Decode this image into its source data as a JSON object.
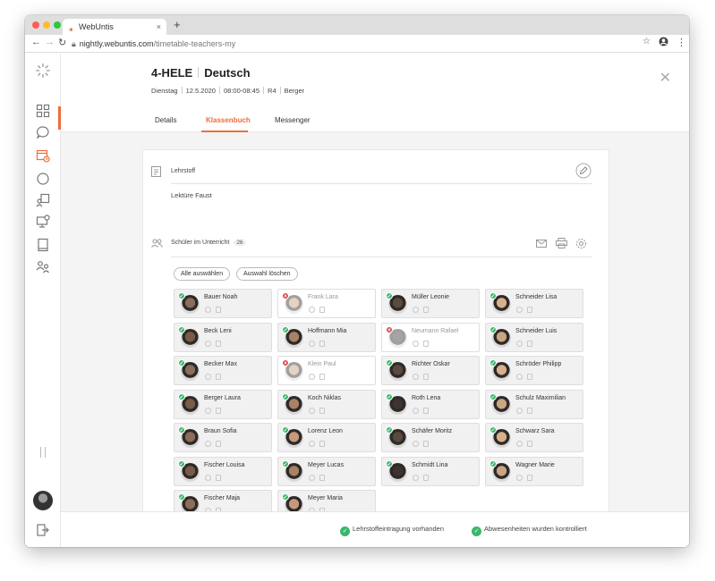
{
  "browser": {
    "tab_title": "WebUntis",
    "url_host": "nightly.webuntis.com",
    "url_path": "/timetable-teachers-my"
  },
  "lesson": {
    "title": "4-HELE",
    "subject": "Deutsch",
    "day": "Dienstag",
    "date": "12.5.2020",
    "time": "08:00-08:45",
    "room": "R4",
    "teacher": "Berger"
  },
  "tabs": [
    "Details",
    "Klassenbuch",
    "Messenger"
  ],
  "active_tab": "Klassenbuch",
  "lehrstoff": {
    "label": "Lehrstoff",
    "text": "Lektüre Faust"
  },
  "students_section": {
    "label": "Schüler im Unterricht",
    "count": "26",
    "select_all": "Alle auswählen",
    "clear_selection": "Auswahl löschen"
  },
  "students": [
    {
      "name": "Bauer Noah",
      "status": "present"
    },
    {
      "name": "Frank Lara",
      "status": "absent"
    },
    {
      "name": "Müller Leonie",
      "status": "present"
    },
    {
      "name": "Schneider Lisa",
      "status": "present"
    },
    {
      "name": "Beck Leni",
      "status": "present"
    },
    {
      "name": "Hoffmann Mia",
      "status": "present"
    },
    {
      "name": "Neumann Rafael",
      "status": "absent"
    },
    {
      "name": "Schneider Luis",
      "status": "present"
    },
    {
      "name": "Becker Max",
      "status": "present"
    },
    {
      "name": "Klein Paul",
      "status": "absent"
    },
    {
      "name": "Richter Oskar",
      "status": "present"
    },
    {
      "name": "Schröder Philipp",
      "status": "present"
    },
    {
      "name": "Berger Laura",
      "status": "present"
    },
    {
      "name": "Koch Niklas",
      "status": "present"
    },
    {
      "name": "Roth Lena",
      "status": "present"
    },
    {
      "name": "Schulz Maximilian",
      "status": "present"
    },
    {
      "name": "Braun Sofia",
      "status": "present"
    },
    {
      "name": "Lorenz Leon",
      "status": "present"
    },
    {
      "name": "Schäfer Moritz",
      "status": "present"
    },
    {
      "name": "Schwarz Sara",
      "status": "present"
    },
    {
      "name": "Fischer Louisa",
      "status": "present"
    },
    {
      "name": "Meyer Lucas",
      "status": "present"
    },
    {
      "name": "Schmidt Lina",
      "status": "present"
    },
    {
      "name": "Wagner Marie",
      "status": "present"
    },
    {
      "name": "Fischer Maja",
      "status": "present"
    },
    {
      "name": "Meyer Maria",
      "status": "present"
    }
  ],
  "footer": {
    "status1": "Lehrstoffeintragung vorhanden",
    "status2": "Abwesenheiten wurden kontrolliert"
  },
  "colors": {
    "accent": "#ef6c3c",
    "present": "#3bb76a",
    "absent": "#e04848"
  }
}
